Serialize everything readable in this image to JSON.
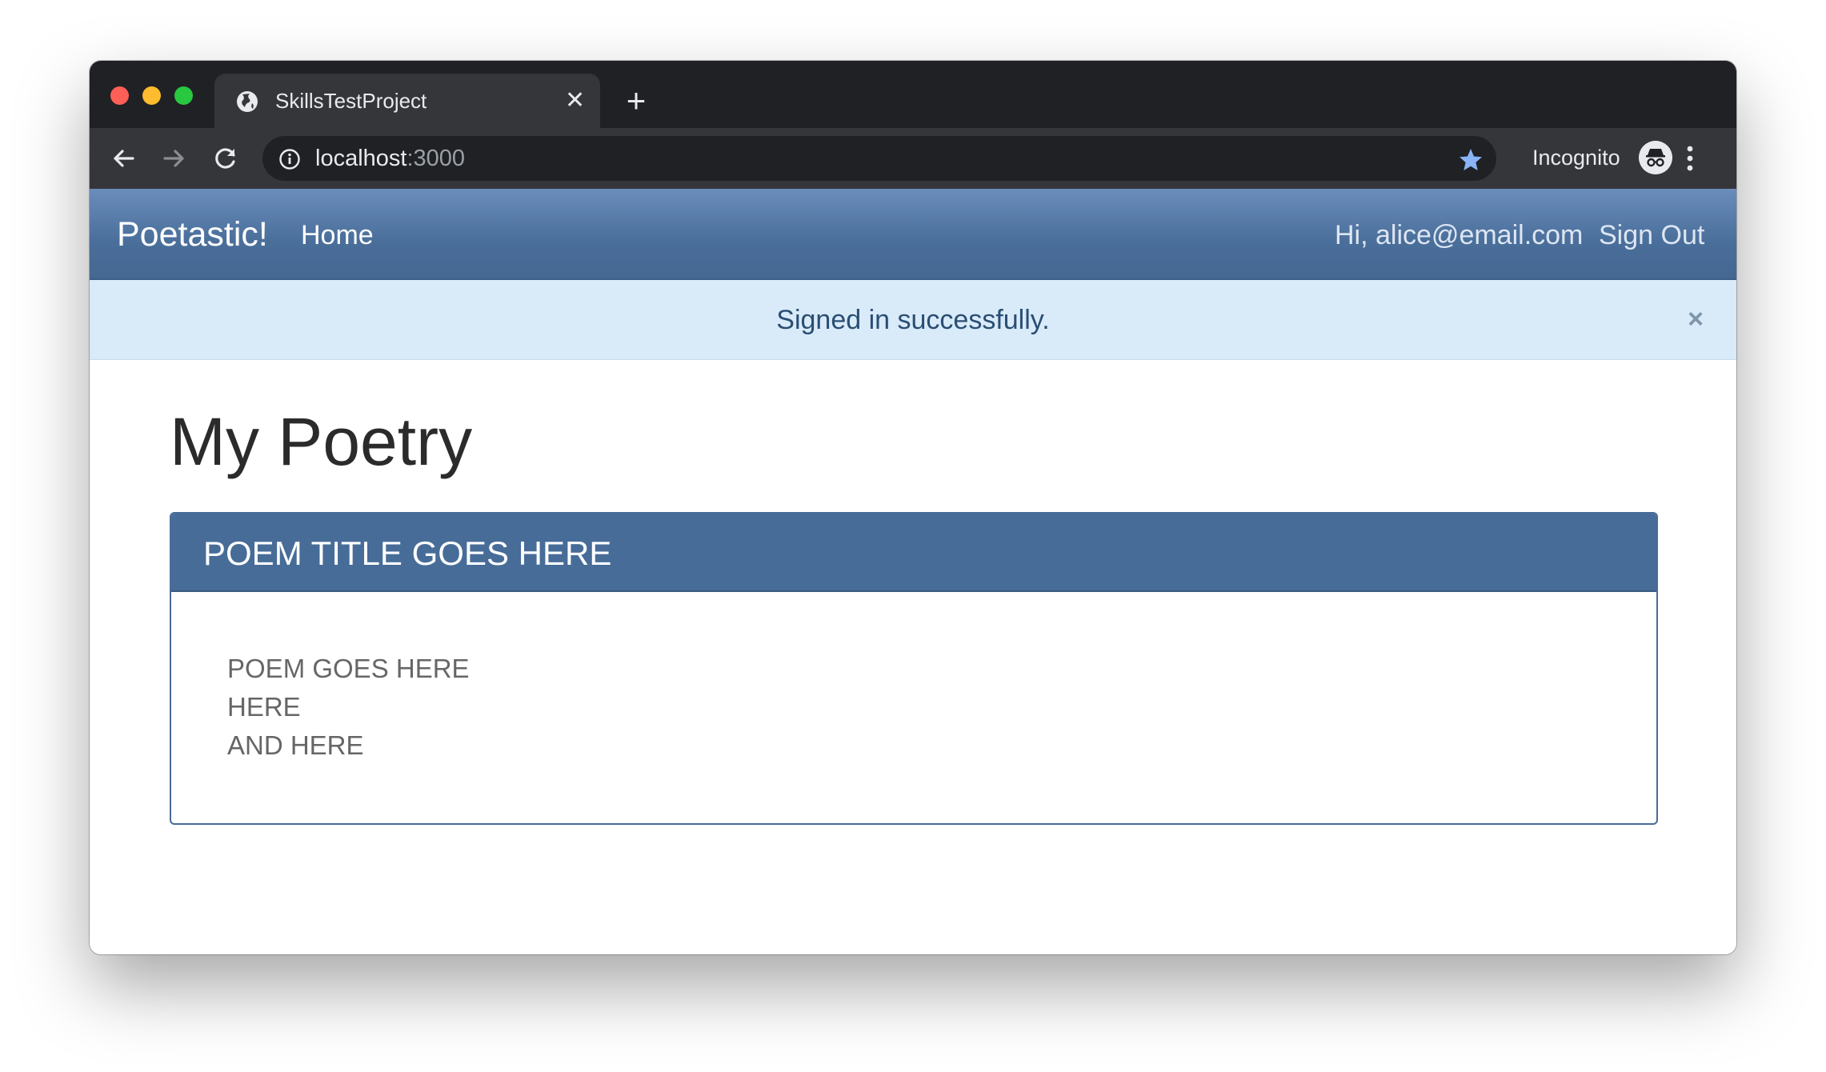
{
  "browser": {
    "tab": {
      "title": "SkillsTestProject",
      "close_glyph": "✕"
    },
    "newtab_glyph": "+",
    "address": {
      "host": "localhost",
      "port": ":3000"
    },
    "profile_label": "Incognito",
    "colors": {
      "frame": "#202124",
      "toolbar": "#35363a",
      "star": "#8ab4f8"
    }
  },
  "app": {
    "brand": "Poetastic!",
    "nav": {
      "home": "Home",
      "greeting": "Hi, alice@email.com",
      "sign_out": "Sign Out"
    },
    "alert": {
      "message": "Signed in successfully.",
      "close_glyph": "×"
    },
    "page_title": "My Poetry",
    "poem": {
      "title": "POEM TITLE GOES HERE",
      "lines": [
        "POEM GOES HERE",
        "HERE",
        "AND HERE"
      ]
    },
    "colors": {
      "primary": "#476c98",
      "alert_bg": "#d9eaf9",
      "alert_text": "#2a4e73"
    }
  }
}
